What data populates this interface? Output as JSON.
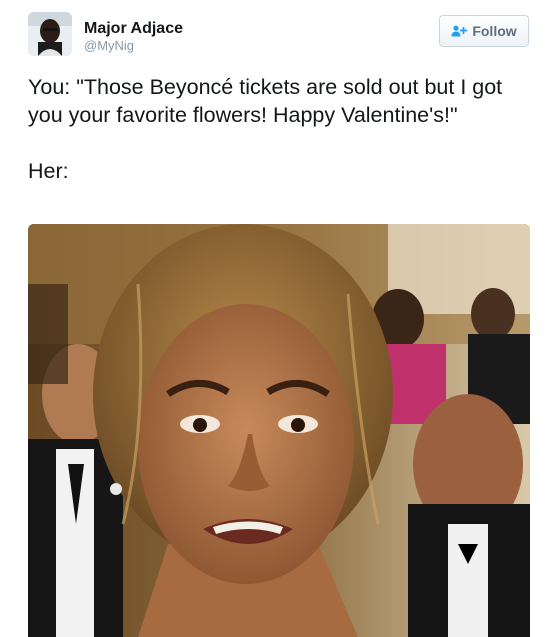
{
  "author": {
    "name": "Major Adjace",
    "handle": "@MyNig"
  },
  "follow_button": {
    "label": "Follow",
    "icon": "add-user-icon",
    "text_color": "#5e6f7e"
  },
  "tweet": {
    "line1": "You: \"Those Beyoncé tickets are sold out but I got you your favorite flowers! Happy Valentine's!\"",
    "line2": "Her:"
  },
  "media": {
    "type": "photo",
    "icon": "photo-image"
  },
  "colors": {
    "text": "#14171a",
    "secondary_text": "#8899a6",
    "button_border": "#c8d6e0"
  }
}
